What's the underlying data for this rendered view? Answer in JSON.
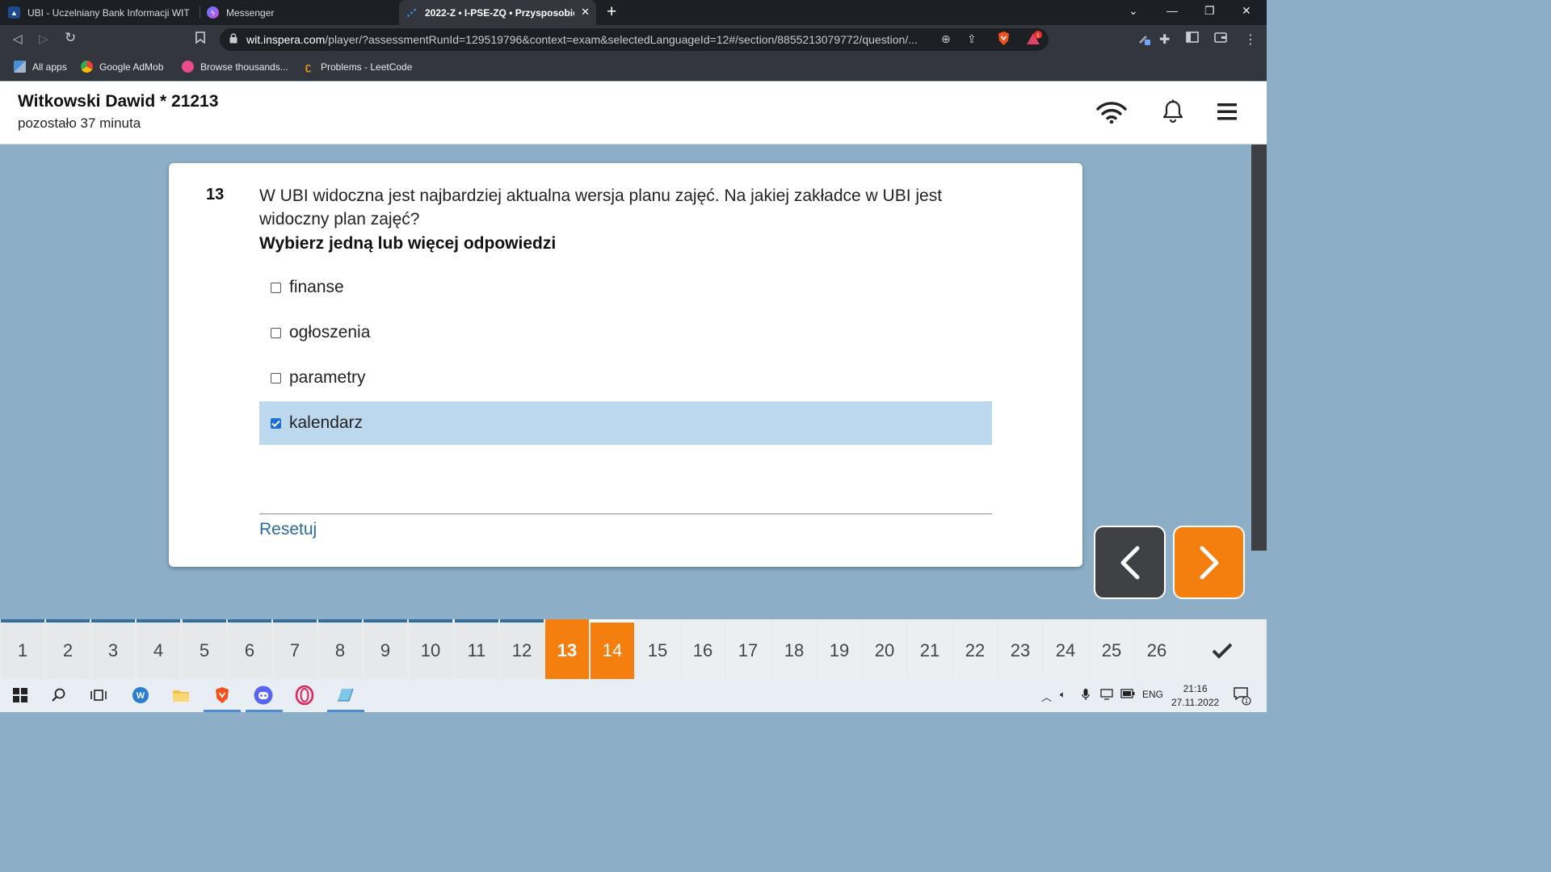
{
  "browser": {
    "tabs": [
      {
        "title": "UBI - Uczelniany Bank Informacji WIT",
        "icon": "ubi-logo-icon",
        "active": false
      },
      {
        "title": "Messenger",
        "icon": "messenger-icon",
        "active": false
      },
      {
        "title": "2022-Z • I-PSE-ZQ • Przysposobie",
        "icon": "inspera-icon",
        "active": true
      }
    ],
    "url_host": "wit.inspera.com",
    "url_path": "/player/?assessmentRunId=129519796&context=exam&selectedLanguageId=12#/section/8855213079772/question/...",
    "bookmarks": [
      {
        "label": "All apps",
        "icon": "apps-grid-icon"
      },
      {
        "label": "Google AdMob",
        "icon": "admob-icon"
      },
      {
        "label": "Browse thousands...",
        "icon": "dribbble-icon"
      },
      {
        "label": "Problems - LeetCode",
        "icon": "leetcode-icon"
      }
    ],
    "brave_badge": "1"
  },
  "header": {
    "student": "Witkowski Dawid * 21213",
    "time_left": "pozostało 37 minuta"
  },
  "question": {
    "number": "13",
    "text": "W UBI widoczna jest najbardziej aktualna wersja planu zajęć. Na jakiej zakładce w UBI jest widoczny plan zajęć?",
    "instruction": "Wybierz jedną lub więcej odpowiedzi",
    "options": [
      {
        "label": "finanse",
        "checked": false
      },
      {
        "label": "ogłoszenia",
        "checked": false
      },
      {
        "label": "parametry",
        "checked": false
      },
      {
        "label": "kalendarz",
        "checked": true
      }
    ],
    "reset_label": "Resetuj"
  },
  "nav": {
    "questions": [
      "1",
      "2",
      "3",
      "4",
      "5",
      "6",
      "7",
      "8",
      "9",
      "10",
      "11",
      "12",
      "13",
      "14",
      "15",
      "16",
      "17",
      "18",
      "19",
      "20",
      "21",
      "22",
      "23",
      "24",
      "25",
      "26"
    ],
    "current": "13",
    "next": "14",
    "answered_through": 12
  },
  "taskbar": {
    "language": "ENG",
    "time": "21:16",
    "date": "27.11.2022",
    "notification_count": "1"
  },
  "colors": {
    "accent_orange": "#f57f0e",
    "selected_option": "#bcd8ef",
    "page_background": "#8cafc7",
    "answered_marker": "#2f6e9e",
    "link": "#2b6aa3"
  }
}
